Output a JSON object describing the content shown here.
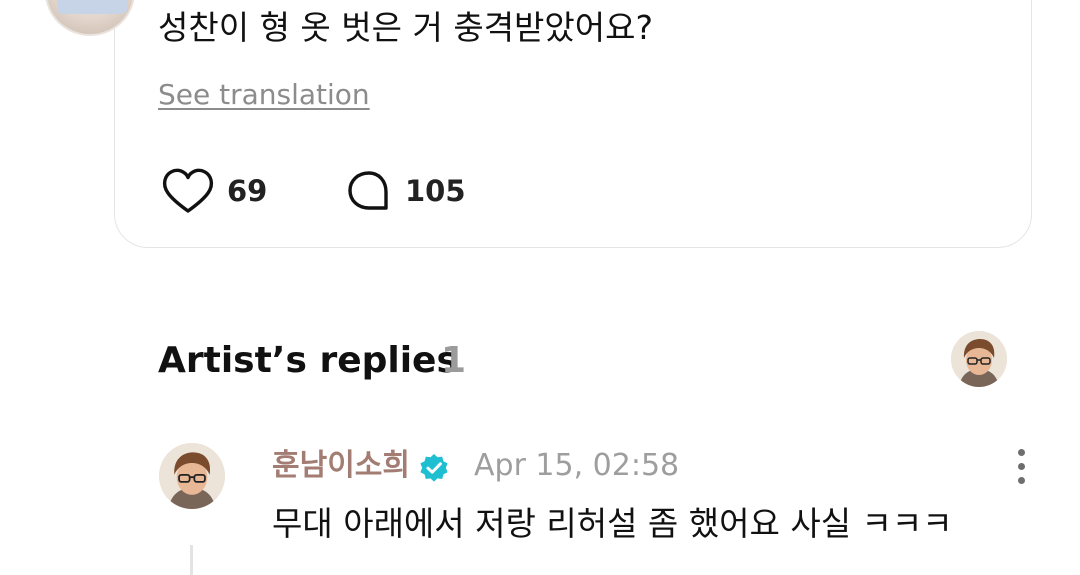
{
  "post": {
    "text": "성찬이 형 옷 벗은 거 충격받았어요?",
    "see_translation": "See translation",
    "likes": "69",
    "comments": "105"
  },
  "replies_section": {
    "title": "Artist’s replies",
    "count": "1"
  },
  "reply": {
    "author": "훈남이소희",
    "timestamp": "Apr 15, 02:58",
    "text": "무대 아래에서 저랑 리허설 좀 했어요 사실 ㅋㅋㅋ"
  },
  "icons": {
    "like": "heart-icon",
    "comment": "comment-bubble-icon",
    "verified": "verified-badge-icon",
    "more": "more-vertical-icon"
  },
  "colors": {
    "author_name": "#a37d73",
    "verified_badge": "#1fbfd2",
    "muted_text": "#8c8c8c",
    "count_gray": "#9b9b9b"
  }
}
